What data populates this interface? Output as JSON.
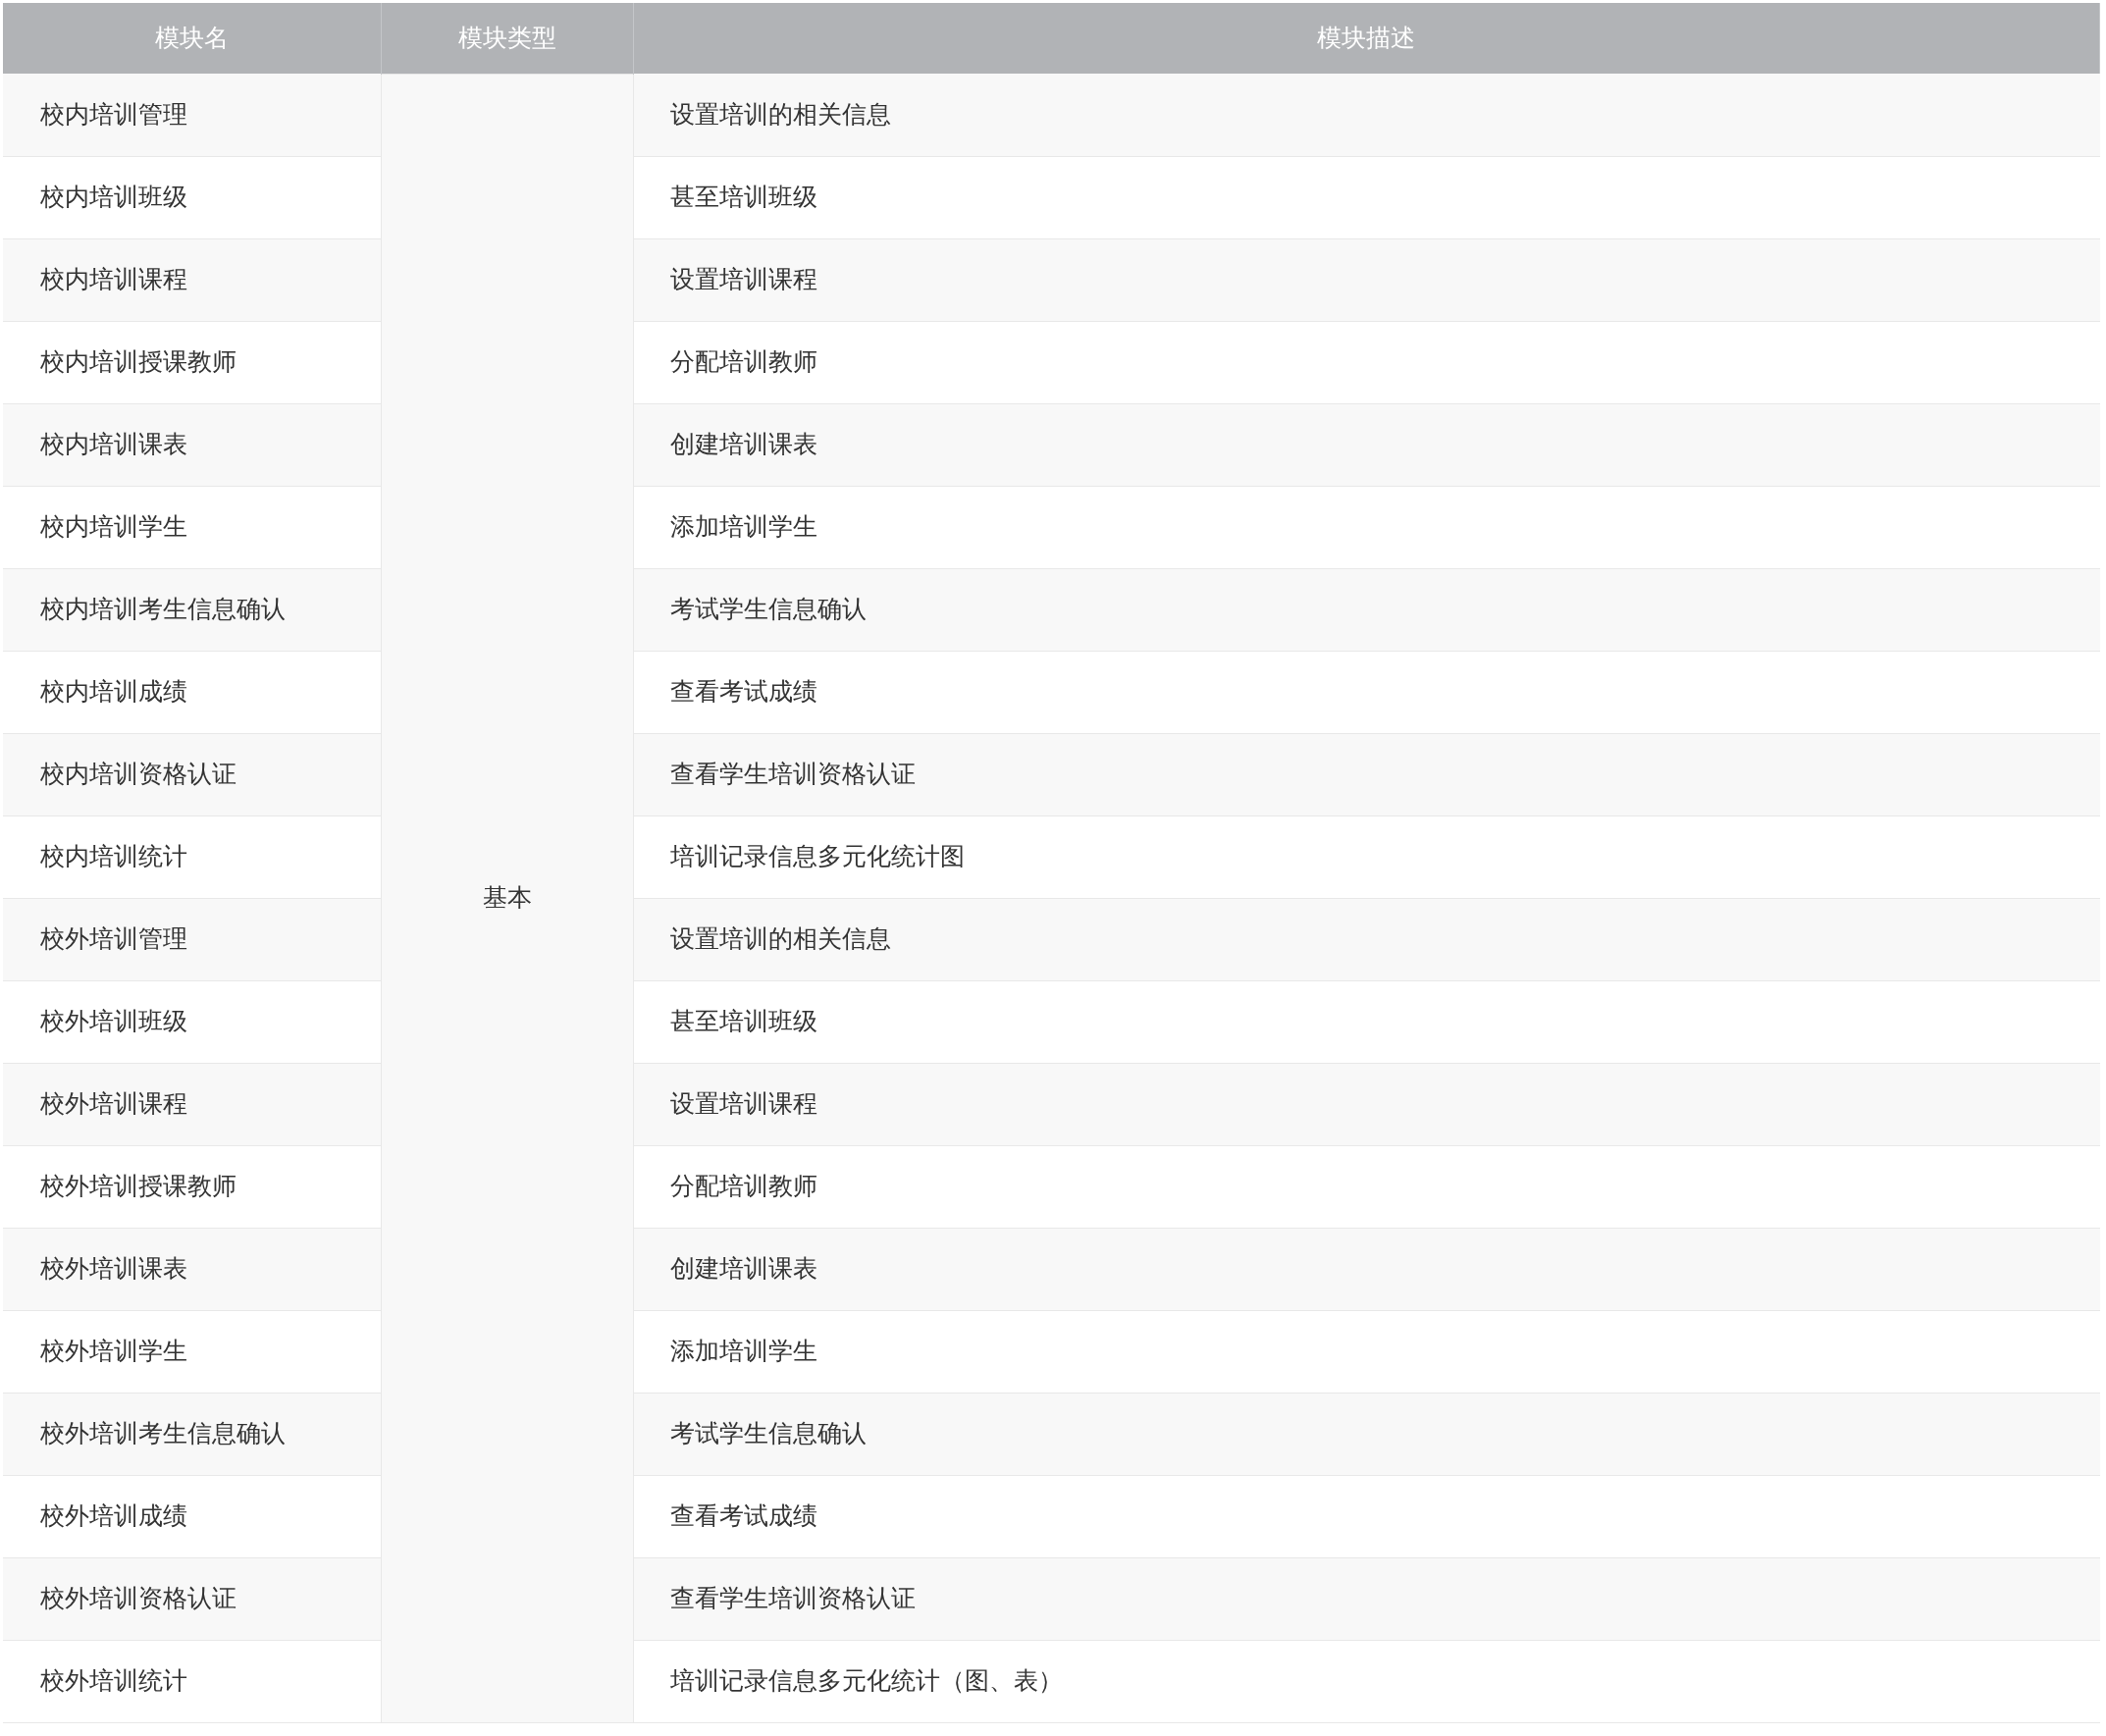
{
  "table": {
    "columns": [
      "模块名",
      "模块类型",
      "模块描述"
    ],
    "merged_type": "基本",
    "rows": [
      {
        "name": "校内培训管理",
        "description": "设置培训的相关信息"
      },
      {
        "name": "校内培训班级",
        "description": "甚至培训班级"
      },
      {
        "name": "校内培训课程",
        "description": "设置培训课程"
      },
      {
        "name": "校内培训授课教师",
        "description": "分配培训教师"
      },
      {
        "name": "校内培训课表",
        "description": "创建培训课表"
      },
      {
        "name": "校内培训学生",
        "description": "添加培训学生"
      },
      {
        "name": "校内培训考生信息确认",
        "description": "考试学生信息确认"
      },
      {
        "name": "校内培训成绩",
        "description": "查看考试成绩"
      },
      {
        "name": "校内培训资格认证",
        "description": "查看学生培训资格认证"
      },
      {
        "name": "校内培训统计",
        "description": "培训记录信息多元化统计图"
      },
      {
        "name": "校外培训管理",
        "description": "设置培训的相关信息"
      },
      {
        "name": "校外培训班级",
        "description": "甚至培训班级"
      },
      {
        "name": "校外培训课程",
        "description": "设置培训课程"
      },
      {
        "name": "校外培训授课教师",
        "description": "分配培训教师"
      },
      {
        "name": "校外培训课表",
        "description": "创建培训课表"
      },
      {
        "name": "校外培训学生",
        "description": "添加培训学生"
      },
      {
        "name": "校外培训考生信息确认",
        "description": "考试学生信息确认"
      },
      {
        "name": "校外培训成绩",
        "description": "查看考试成绩"
      },
      {
        "name": "校外培训资格认证",
        "description": "查看学生培训资格认证"
      },
      {
        "name": "校外培训统计",
        "description": "培训记录信息多元化统计（图、表）"
      }
    ]
  }
}
